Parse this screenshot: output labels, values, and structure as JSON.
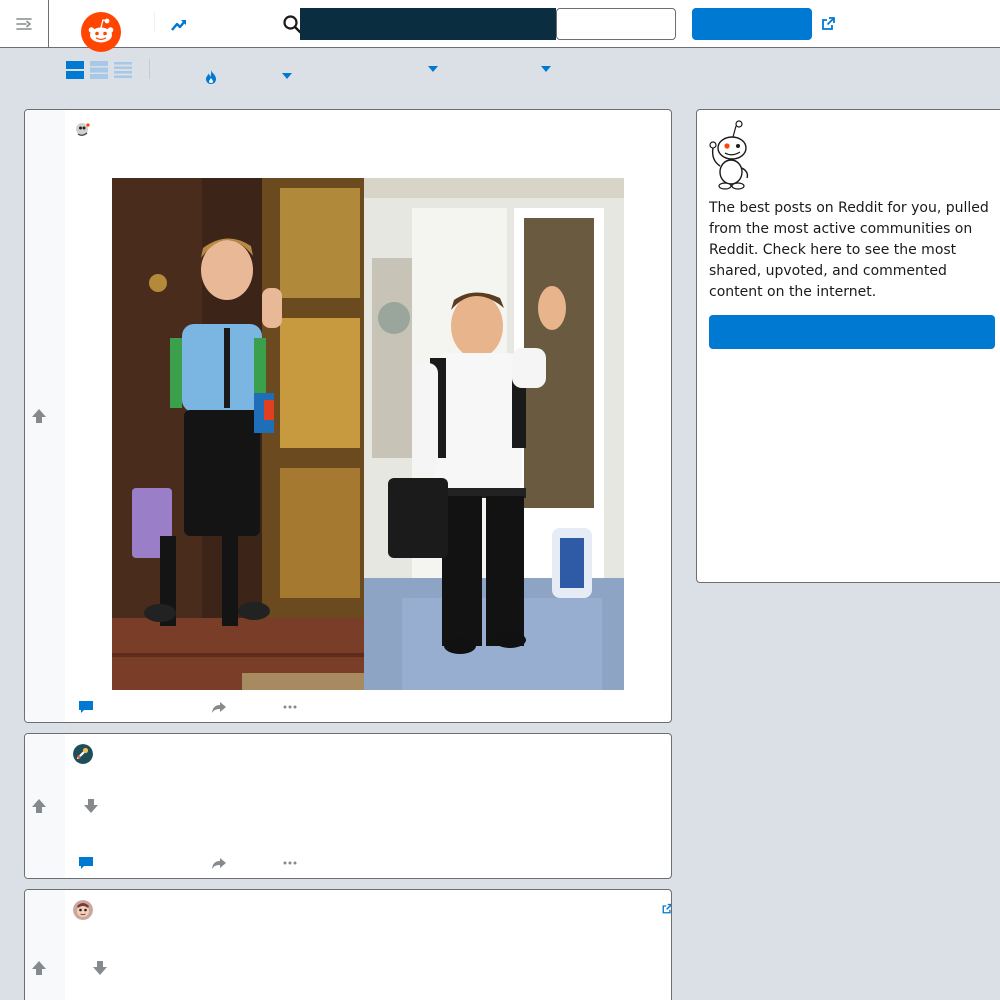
{
  "header": {
    "search": {
      "placeholder": "",
      "value": ""
    },
    "login_label": "",
    "signup_label": "",
    "icons": [
      "menu-icon",
      "reddit-logo",
      "trending-icon",
      "search-icon",
      "external-link-icon"
    ],
    "colors": {
      "brand": "#ff4500",
      "accent": "#0079d3",
      "search_bg": "#0a2e3f"
    }
  },
  "sort_bar": {
    "views": [
      "card-view-icon",
      "classic-view-icon",
      "compact-view-icon"
    ],
    "selected_view": "card",
    "sort_icon": "hot-flame-icon",
    "dropdowns": 3
  },
  "posts": [
    {
      "title": "",
      "has_image": true,
      "image_description": "side-by-side photo",
      "actions": [
        "comment-icon",
        "share-icon",
        "more-icon"
      ]
    },
    {
      "title": "",
      "has_image": false,
      "actions": [
        "comment-icon",
        "share-icon",
        "more-icon"
      ]
    },
    {
      "title": "",
      "has_image": false,
      "has_external_link": true
    }
  ],
  "sidebar": {
    "description": "The best posts on Reddit for you, pulled from the most active communities on Reddit. Check here to see the most shared, upvoted, and commented content on the internet.",
    "button_label": ""
  }
}
